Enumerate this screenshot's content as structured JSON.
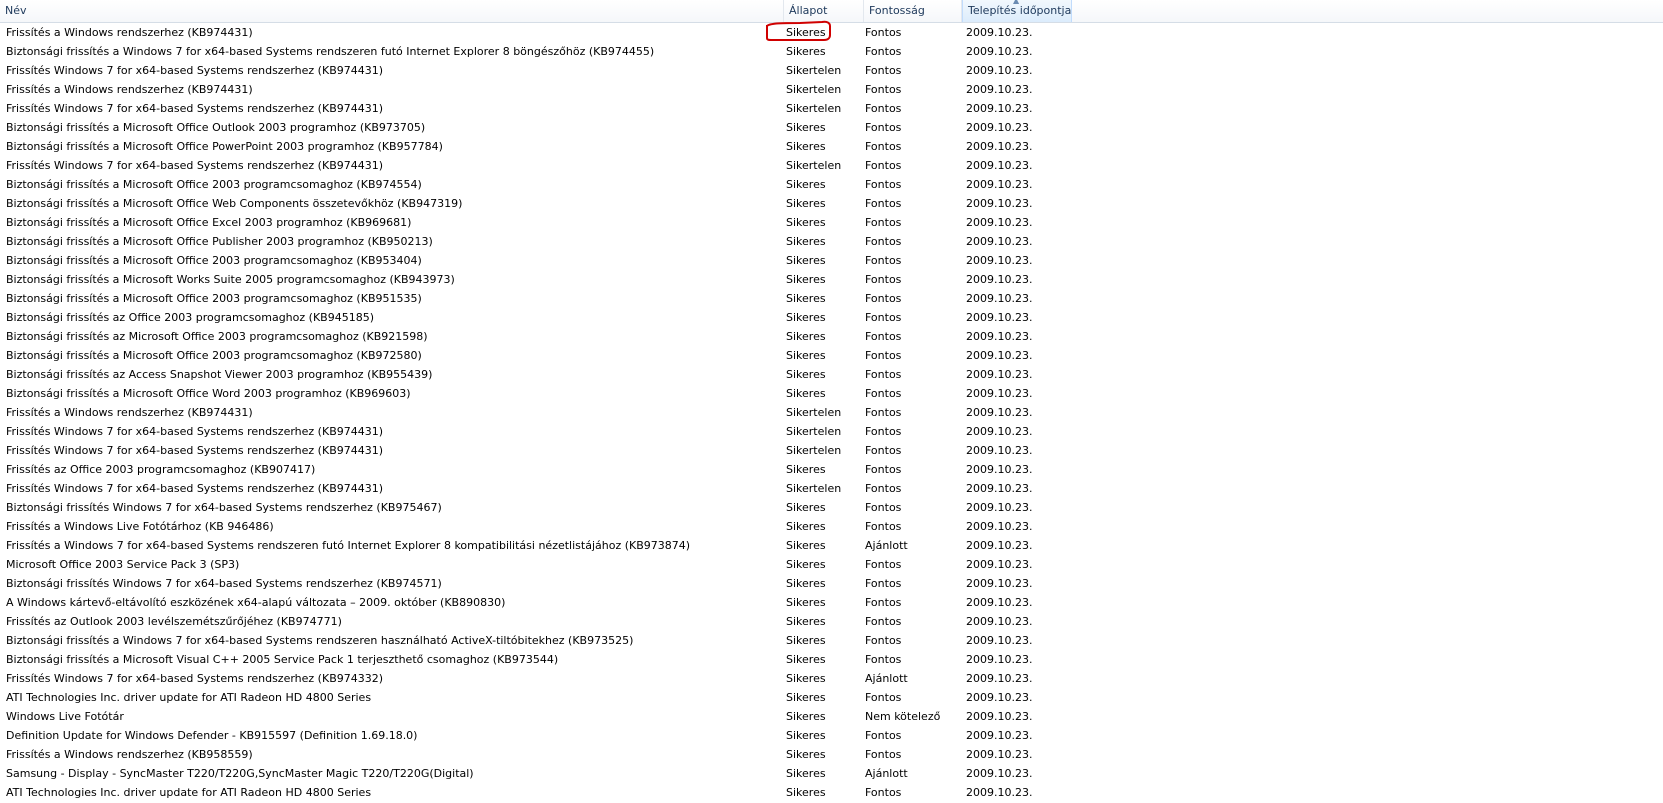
{
  "columns": {
    "name": "Név",
    "state": "Állapot",
    "importance": "Fontosság",
    "date": "Telepítés időpontja"
  },
  "annotation_color": "#d00000",
  "rows": [
    {
      "name": "Frissítés a Windows rendszerhez (KB974431)",
      "state": "Sikeres",
      "importance": "Fontos",
      "date": "2009.10.23."
    },
    {
      "name": "Biztonsági frissítés a Windows 7 for x64-based Systems rendszeren futó Internet Explorer 8 böngészőhöz (KB974455)",
      "state": "Sikeres",
      "importance": "Fontos",
      "date": "2009.10.23."
    },
    {
      "name": "Frissítés Windows 7 for x64-based Systems rendszerhez (KB974431)",
      "state": "Sikertelen",
      "importance": "Fontos",
      "date": "2009.10.23."
    },
    {
      "name": "Frissítés a Windows rendszerhez (KB974431)",
      "state": "Sikertelen",
      "importance": "Fontos",
      "date": "2009.10.23."
    },
    {
      "name": "Frissítés Windows 7 for x64-based Systems rendszerhez (KB974431)",
      "state": "Sikertelen",
      "importance": "Fontos",
      "date": "2009.10.23."
    },
    {
      "name": "Biztonsági frissítés a Microsoft Office Outlook 2003 programhoz (KB973705)",
      "state": "Sikeres",
      "importance": "Fontos",
      "date": "2009.10.23."
    },
    {
      "name": "Biztonsági frissítés a Microsoft Office PowerPoint 2003 programhoz (KB957784)",
      "state": "Sikeres",
      "importance": "Fontos",
      "date": "2009.10.23."
    },
    {
      "name": "Frissítés Windows 7 for x64-based Systems rendszerhez (KB974431)",
      "state": "Sikertelen",
      "importance": "Fontos",
      "date": "2009.10.23."
    },
    {
      "name": "Biztonsági frissítés a Microsoft Office 2003 programcsomaghoz (KB974554)",
      "state": "Sikeres",
      "importance": "Fontos",
      "date": "2009.10.23."
    },
    {
      "name": "Biztonsági frissítés a Microsoft Office Web Components összetevőkhöz (KB947319)",
      "state": "Sikeres",
      "importance": "Fontos",
      "date": "2009.10.23."
    },
    {
      "name": "Biztonsági frissítés a Microsoft Office Excel 2003 programhoz (KB969681)",
      "state": "Sikeres",
      "importance": "Fontos",
      "date": "2009.10.23."
    },
    {
      "name": "Biztonsági frissítés a Microsoft Office Publisher 2003 programhoz (KB950213)",
      "state": "Sikeres",
      "importance": "Fontos",
      "date": "2009.10.23."
    },
    {
      "name": "Biztonsági frissítés a Microsoft Office 2003 programcsomaghoz (KB953404)",
      "state": "Sikeres",
      "importance": "Fontos",
      "date": "2009.10.23."
    },
    {
      "name": "Biztonsági frissítés a Microsoft Works Suite 2005 programcsomaghoz (KB943973)",
      "state": "Sikeres",
      "importance": "Fontos",
      "date": "2009.10.23."
    },
    {
      "name": "Biztonsági frissítés a Microsoft Office 2003 programcsomaghoz (KB951535)",
      "state": "Sikeres",
      "importance": "Fontos",
      "date": "2009.10.23."
    },
    {
      "name": "Biztonsági frissítés az Office 2003 programcsomaghoz (KB945185)",
      "state": "Sikeres",
      "importance": "Fontos",
      "date": "2009.10.23."
    },
    {
      "name": "Biztonsági frissítés az Microsoft Office 2003 programcsomaghoz (KB921598)",
      "state": "Sikeres",
      "importance": "Fontos",
      "date": "2009.10.23."
    },
    {
      "name": "Biztonsági frissítés a Microsoft Office 2003 programcsomaghoz (KB972580)",
      "state": "Sikeres",
      "importance": "Fontos",
      "date": "2009.10.23."
    },
    {
      "name": "Biztonsági frissítés az Access Snapshot Viewer 2003 programhoz (KB955439)",
      "state": "Sikeres",
      "importance": "Fontos",
      "date": "2009.10.23."
    },
    {
      "name": "Biztonsági frissítés a Microsoft Office Word 2003 programhoz (KB969603)",
      "state": "Sikeres",
      "importance": "Fontos",
      "date": "2009.10.23."
    },
    {
      "name": "Frissítés a Windows rendszerhez (KB974431)",
      "state": "Sikertelen",
      "importance": "Fontos",
      "date": "2009.10.23."
    },
    {
      "name": "Frissítés Windows 7 for x64-based Systems rendszerhez (KB974431)",
      "state": "Sikertelen",
      "importance": "Fontos",
      "date": "2009.10.23."
    },
    {
      "name": "Frissítés Windows 7 for x64-based Systems rendszerhez (KB974431)",
      "state": "Sikertelen",
      "importance": "Fontos",
      "date": "2009.10.23."
    },
    {
      "name": "Frissítés az Office 2003 programcsomaghoz (KB907417)",
      "state": "Sikeres",
      "importance": "Fontos",
      "date": "2009.10.23."
    },
    {
      "name": "Frissítés Windows 7 for x64-based Systems rendszerhez (KB974431)",
      "state": "Sikertelen",
      "importance": "Fontos",
      "date": "2009.10.23."
    },
    {
      "name": "Biztonsági frissítés Windows 7 for x64-based Systems rendszerhez (KB975467)",
      "state": "Sikeres",
      "importance": "Fontos",
      "date": "2009.10.23."
    },
    {
      "name": "Frissítés a Windows Live Fotótárhoz (KB 946486)",
      "state": "Sikeres",
      "importance": "Fontos",
      "date": "2009.10.23."
    },
    {
      "name": "Frissítés a Windows 7 for x64-based Systems rendszeren futó Internet Explorer 8 kompatibilitási nézetlistájához (KB973874)",
      "state": "Sikeres",
      "importance": "Ajánlott",
      "date": "2009.10.23."
    },
    {
      "name": "Microsoft Office 2003 Service Pack 3 (SP3)",
      "state": "Sikeres",
      "importance": "Fontos",
      "date": "2009.10.23."
    },
    {
      "name": "Biztonsági frissítés Windows 7 for x64-based Systems rendszerhez (KB974571)",
      "state": "Sikeres",
      "importance": "Fontos",
      "date": "2009.10.23."
    },
    {
      "name": "A Windows kártevő-eltávolító eszközének x64-alapú változata – 2009. október (KB890830)",
      "state": "Sikeres",
      "importance": "Fontos",
      "date": "2009.10.23."
    },
    {
      "name": "Frissítés az Outlook 2003 levélszemétszűrőjéhez (KB974771)",
      "state": "Sikeres",
      "importance": "Fontos",
      "date": "2009.10.23."
    },
    {
      "name": "Biztonsági frissítés a Windows 7 for x64-based Systems rendszeren használható ActiveX-tiltóbitekhez (KB973525)",
      "state": "Sikeres",
      "importance": "Fontos",
      "date": "2009.10.23."
    },
    {
      "name": "Biztonsági frissítés a Microsoft Visual C++ 2005 Service Pack 1 terjeszthető csomaghoz (KB973544)",
      "state": "Sikeres",
      "importance": "Fontos",
      "date": "2009.10.23."
    },
    {
      "name": "Frissítés Windows 7 for x64-based Systems rendszerhez (KB974332)",
      "state": "Sikeres",
      "importance": "Ajánlott",
      "date": "2009.10.23."
    },
    {
      "name": "ATI Technologies Inc. driver update for ATI Radeon HD 4800 Series",
      "state": "Sikeres",
      "importance": "Fontos",
      "date": "2009.10.23."
    },
    {
      "name": "Windows Live Fotótár",
      "state": "Sikeres",
      "importance": "Nem kötelező",
      "date": "2009.10.23."
    },
    {
      "name": "Definition Update for Windows Defender - KB915597 (Definition 1.69.18.0)",
      "state": "Sikeres",
      "importance": "Fontos",
      "date": "2009.10.23."
    },
    {
      "name": "Frissítés a Windows rendszerhez (KB958559)",
      "state": "Sikeres",
      "importance": "Fontos",
      "date": "2009.10.23."
    },
    {
      "name": "Samsung - Display - SyncMaster T220/T220G,SyncMaster Magic T220/T220G(Digital)",
      "state": "Sikeres",
      "importance": "Ajánlott",
      "date": "2009.10.23."
    },
    {
      "name": "ATI Technologies Inc. driver update for ATI Radeon HD 4800 Series",
      "state": "Sikeres",
      "importance": "Fontos",
      "date": "2009.10.23."
    }
  ]
}
